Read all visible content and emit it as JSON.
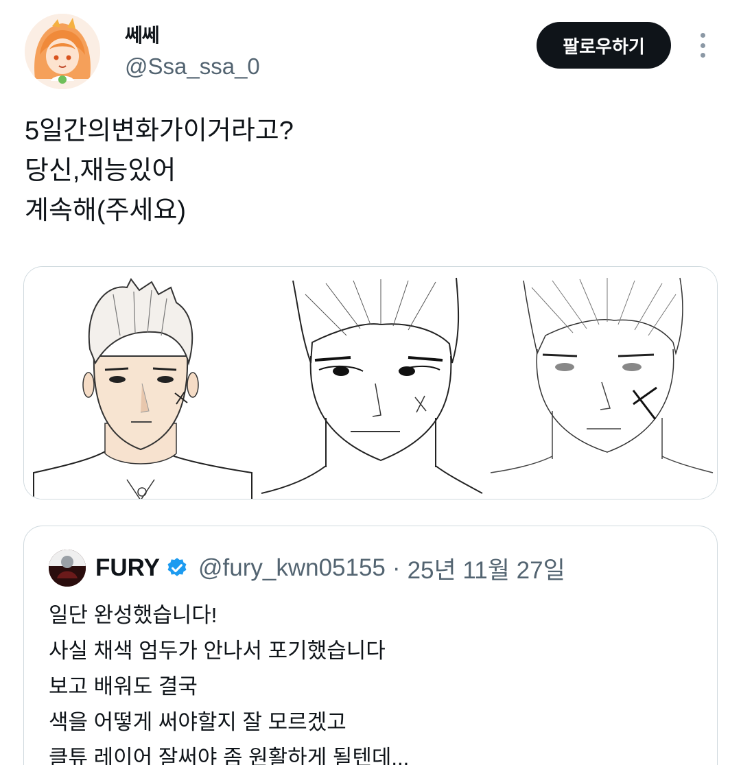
{
  "author": {
    "display_name": "쎄쎄",
    "handle": "@Ssa_ssa_0",
    "avatar_icon": "anime-girl-avatar-icon"
  },
  "actions": {
    "follow_label": "팔로우하기",
    "more_icon": "more-vertical-icon"
  },
  "tweet": {
    "lines": [
      "5일간의변화가이거라고?",
      "당신,재능있어",
      "계속해(주세요)"
    ]
  },
  "media": {
    "description_icon": "drawing-comparison-image"
  },
  "quoted": {
    "display_name": "FURY",
    "verified_icon": "verified-badge-icon",
    "handle": "@fury_kwn05155",
    "separator": "·",
    "date": "25년 11월 27일",
    "lines": [
      "일단 완성했습니다!",
      "사실 채색 엄두가 안나서 포기했습니다",
      "보고 배워도 결국",
      "색을 어떻게 써야할지 잘 모르겠고",
      "클튜 레이어 잘써야 좀 원활하게 될텐데..."
    ]
  },
  "colors": {
    "text": "#0f1419",
    "secondary": "#536471",
    "border": "#cfd9de",
    "verified": "#1d9bf0"
  }
}
